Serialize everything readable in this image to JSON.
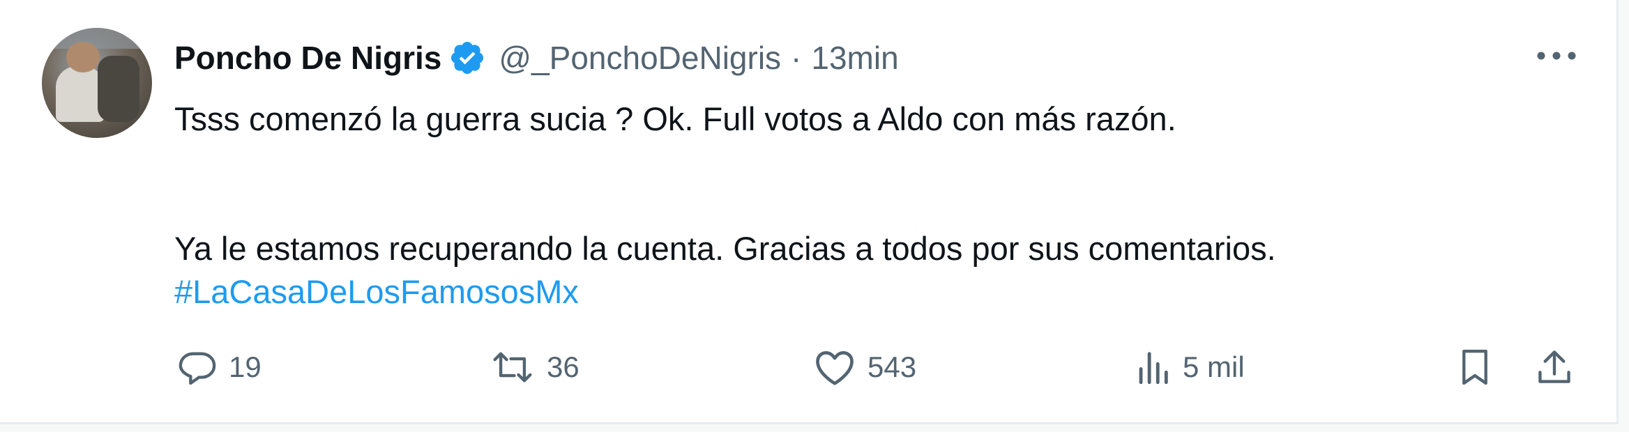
{
  "tweet": {
    "author_name": "Poncho De Nigris",
    "handle": "@_PonchoDeNigris",
    "separator": "·",
    "time": "13min",
    "text_line1": "Tsss comenzó la guerra sucia ? Ok. Full votos a Aldo con más razón.",
    "text_line2": "Ya le estamos recuperando la cuenta. Gracias a todos por sus comentarios.",
    "hashtag": "#LaCasaDeLosFamososMx",
    "verified": true
  },
  "actions": {
    "replies": "19",
    "retweets": "36",
    "likes": "543",
    "views": "5 mil"
  },
  "icons": {
    "verified": "verified-badge-icon",
    "more": "more-options-icon",
    "reply": "reply-icon",
    "retweet": "retweet-icon",
    "like": "heart-icon",
    "views": "views-chart-icon",
    "bookmark": "bookmark-icon",
    "share": "share-icon"
  },
  "colors": {
    "text": "#0f1419",
    "secondary": "#536471",
    "link": "#1d9bf0",
    "verified": "#1d9bf0"
  }
}
